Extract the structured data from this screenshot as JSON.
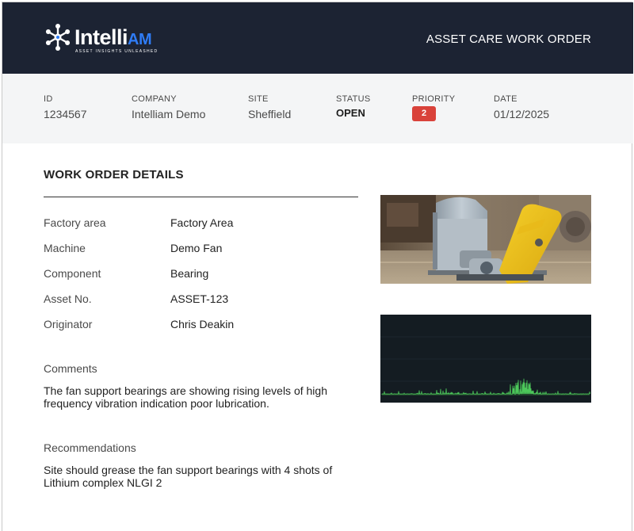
{
  "header": {
    "logo_main": "Intelli",
    "logo_accent": "AM",
    "logo_tagline": "ASSET INSIGHTS UNLEASHED",
    "title": "ASSET CARE WORK ORDER"
  },
  "meta": {
    "id": {
      "label": "ID",
      "value": "1234567"
    },
    "company": {
      "label": "COMPANY",
      "value": "Intelliam Demo"
    },
    "site": {
      "label": "SITE",
      "value": "Sheffield"
    },
    "status": {
      "label": "STATUS",
      "value": "OPEN"
    },
    "priority": {
      "label": "PRIORITY",
      "value": "2"
    },
    "date": {
      "label": "DATE",
      "value": "01/12/2025"
    }
  },
  "details": {
    "title": "WORK ORDER DETAILS",
    "rows": [
      {
        "label": "Factory area",
        "value": "Factory Area"
      },
      {
        "label": "Machine",
        "value": "Demo Fan"
      },
      {
        "label": "Component",
        "value": "Bearing"
      },
      {
        "label": "Asset No.",
        "value": "ASSET-123"
      },
      {
        "label": "Originator",
        "value": "Chris Deakin"
      }
    ],
    "comments_label": "Comments",
    "comments_text": "The fan support bearings are showing rising levels of high frequency vibration indication poor lubrication.",
    "recommendations_label": "Recommendations",
    "recommendations_text": "Site should grease the fan support bearings with 4 shots of Lithium complex NLGI 2"
  },
  "colors": {
    "header_bg": "#1c2333",
    "accent": "#2f7cf6",
    "priority_badge": "#d9423a",
    "spectrum_line": "#4fd15e"
  }
}
